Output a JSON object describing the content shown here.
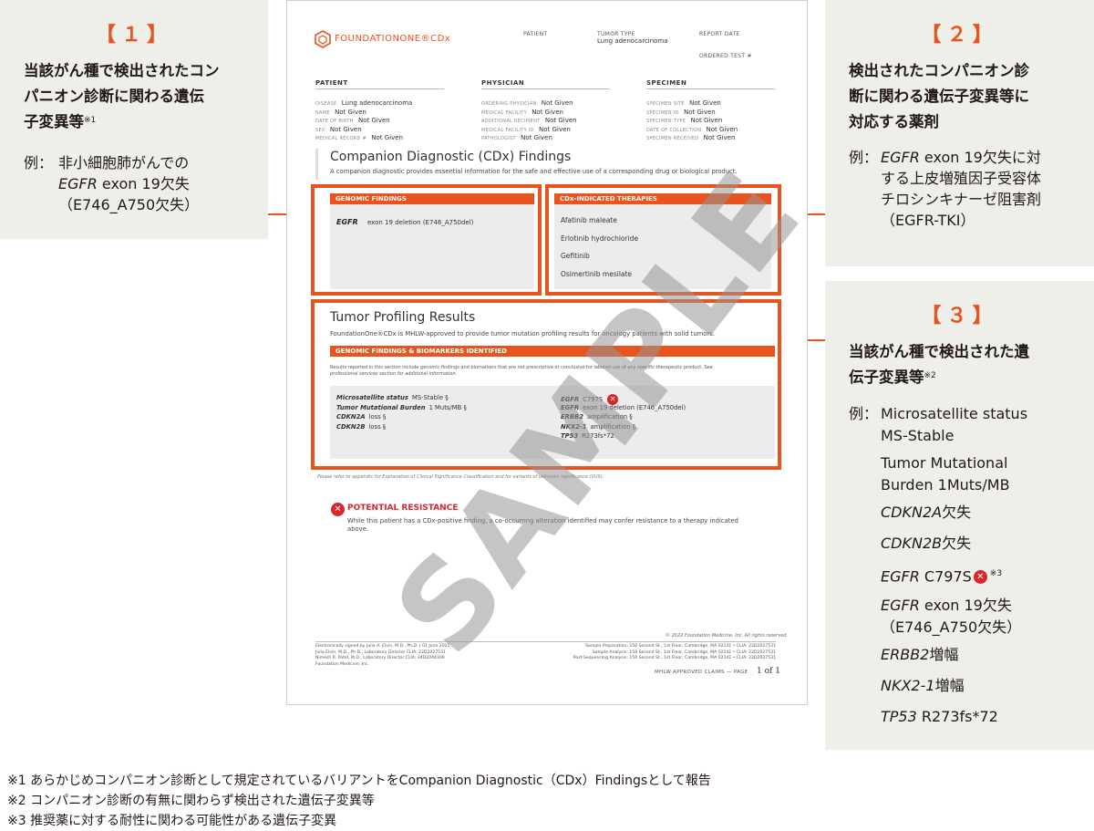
{
  "panel1": {
    "number": "【１】",
    "title_lines": [
      "当該がん種で検出されたコン",
      "パニオン診断に関わる遺伝",
      "子変異等"
    ],
    "title_note": "※1",
    "example_label": "例：",
    "example_lines": [
      "非小細胞肺がんでの",
      "EGFR exon 19欠失",
      "（E746_A750欠失）"
    ]
  },
  "panel2": {
    "number": "【２】",
    "title_lines": [
      "検出されたコンパニオン診",
      "断に関わる遺伝子変異等に",
      "対応する薬剤"
    ],
    "example_label": "例：",
    "example_lines": [
      "EGFR exon 19欠失に対",
      "する上皮増殖因子受容体",
      "チロシンキナーゼ阻害剤",
      "（EGFR-TKI）"
    ]
  },
  "panel3": {
    "number": "【３】",
    "title_lines": [
      "当該がん種で検出された遺",
      "伝子変異等"
    ],
    "title_note": "※2",
    "example_label": "例：",
    "items": [
      {
        "gene": "",
        "text": "Microsatellite status"
      },
      {
        "gene": "",
        "text": "MS-Stable"
      },
      {
        "gene": "",
        "text": "Tumor Mutational"
      },
      {
        "gene": "",
        "text": "Burden 1Muts/MB"
      },
      {
        "gene": "CDKN2A",
        "text": "欠失"
      },
      {
        "gene": "CDKN2B",
        "text": "欠失"
      },
      {
        "gene": "EGFR",
        "text": " C797S",
        "note": "※3",
        "resist": true
      },
      {
        "gene": "EGFR",
        "text": " exon 19欠失"
      },
      {
        "gene": "",
        "text": "（E746_A750欠失）"
      },
      {
        "gene": "ERBB2",
        "text": "増幅"
      },
      {
        "gene": "NKX2-1",
        "text": "増幅"
      },
      {
        "gene": "TP53",
        "text": " R273fs*72"
      }
    ]
  },
  "report": {
    "logo_text": "FOUNDATIONONE®CDx",
    "top_patient": "PATIENT",
    "top_tumor": "TUMOR TYPE",
    "top_tumor_value": "Lung adenocarcinoma",
    "top_report_date": "REPORT DATE",
    "top_ordered": "ORDERED TEST #",
    "patient_head": "PATIENT",
    "physician_head": "PHYSICIAN",
    "specimen_head": "SPECIMEN",
    "patient_rows": [
      {
        "k": "DISEASE",
        "v": "Lung adenocarcinoma"
      },
      {
        "k": "NAME",
        "v": "Not Given"
      },
      {
        "k": "DATE OF BIRTH",
        "v": "Not Given"
      },
      {
        "k": "SEX",
        "v": "Not Given"
      },
      {
        "k": "MEDICAL RECORD #",
        "v": "Not Given"
      }
    ],
    "physician_rows": [
      {
        "k": "ORDERING PHYSICIAN",
        "v": "Not Given"
      },
      {
        "k": "MEDICAL FACILITY",
        "v": "Not Given"
      },
      {
        "k": "ADDITIONAL RECIPIENT",
        "v": "Not Given"
      },
      {
        "k": "MEDICAL FACILITY ID",
        "v": "Not Given"
      },
      {
        "k": "PATHOLOGIST",
        "v": "Not Given"
      }
    ],
    "specimen_rows": [
      {
        "k": "SPECIMEN SITE",
        "v": "Not Given"
      },
      {
        "k": "SPECIMEN ID",
        "v": "Not Given"
      },
      {
        "k": "SPECIMEN TYPE",
        "v": "Not Given"
      },
      {
        "k": "DATE OF COLLECTION",
        "v": "Not Given"
      },
      {
        "k": "SPECIMEN RECEIVED",
        "v": "Not Given"
      }
    ],
    "cdx_title": "Companion Diagnostic (CDx) Findings",
    "cdx_desc": "A companion diagnostic provides essential information for the safe and effective use of a corresponding drug or biological product.",
    "genomic_findings_head": "GENOMIC FINDINGS",
    "genomic_gene": "EGFR",
    "genomic_desc": "exon 19 deletion (E746_A750del)",
    "therapies_head": "CDx-INDICATED THERAPIES",
    "therapies": [
      "Afatinib maleate",
      "Erlotinib hydrochloride",
      "Gefitinib",
      "Osimertinib mesilate"
    ],
    "tp_title": "Tumor Profiling Results",
    "tp_desc": "FoundationOne®CDx is MHLW-approved to provide tumor mutation profiling results for oncology patients with solid tumors.",
    "tp_bar": "GENOMIC FINDINGS & BIOMARKERS IDENTIFIED",
    "tp_note1": "Results reported in this section include genomic findings and biomarkers that are not prescriptive or conclusive for labeled use of any specific therapeutic product. See",
    "tp_note2": "professional services section for additional information.",
    "left_results": [
      {
        "g": "Microsatellite status",
        "v": "MS-Stable §"
      },
      {
        "g": "Tumor Mutational Burden",
        "v": "1 Muts/MB §"
      },
      {
        "g": "CDKN2A",
        "v": "loss §"
      },
      {
        "g": "CDKN2B",
        "v": "loss §"
      }
    ],
    "right_results": [
      {
        "g": "EGFR",
        "v": "C797S"
      },
      {
        "g": "EGFR",
        "v": "exon 19 deletion (E746_A750del)"
      },
      {
        "g": "ERBB2",
        "v": "amplification §"
      },
      {
        "g": "NKX2-1",
        "v": "amplification §"
      },
      {
        "g": "TP53",
        "v": "R273fs*72"
      }
    ],
    "appendix_note": "Please refer to appendix for Explanation of Clinical Significance Classification and for variants of unknown significance (VUS).",
    "resistance_title": "POTENTIAL RESISTANCE",
    "resistance_line1": "While this patient has a CDx-positive finding, a co-occurring alteration identified may confer resistance to a therapy indicated",
    "resistance_line2": "above.",
    "copyright": "© 2022 Foundation Medicine, Inc. All rights reserved.",
    "sign_lines": [
      "Electronically signed by Julia A. Elvin, M.D., Ph.D. | 01 June 2021",
      "Julia Elvin, M.D., Ph.D., Laboratory Director CLIA: 22D2027531",
      "Nimesh R. Patel, M.D., Laboratory Director CLIA: 34D2044309",
      "Foundation Medicine, Inc."
    ],
    "lab_lines": [
      "Sample Preparation: 150 Second St., 1st Floor, Cambridge, MA 02141 • CLIA: 22D2027531",
      "Sample Analysis: 150 Second St., 1st Floor, Cambridge, MA 02141 • CLIA: 22D2027531",
      "Post-Sequencing Analysis: 150 Second St., 1st Floor, Cambridge, MA 02141 • CLIA: 22D2027531"
    ],
    "page_label": "MHLW APPROVED CLAIMS — PAGE",
    "page_value": "1 of 1",
    "watermark": "SAMPLE"
  },
  "footnotes": [
    "※1 あらかじめコンパニオン診断として規定されているバリアントをCompanion Diagnostic（CDx）Findingsとして報告",
    "※2 コンパニオン診断の有無に関わらず検出された遺伝子変異等",
    "※3 推奨薬に対する耐性に関わる可能性がある遺伝子変異"
  ],
  "colors": {
    "accent": "#e8541e",
    "panel_bg": "#efefea",
    "resist_red": "#d9262c"
  }
}
